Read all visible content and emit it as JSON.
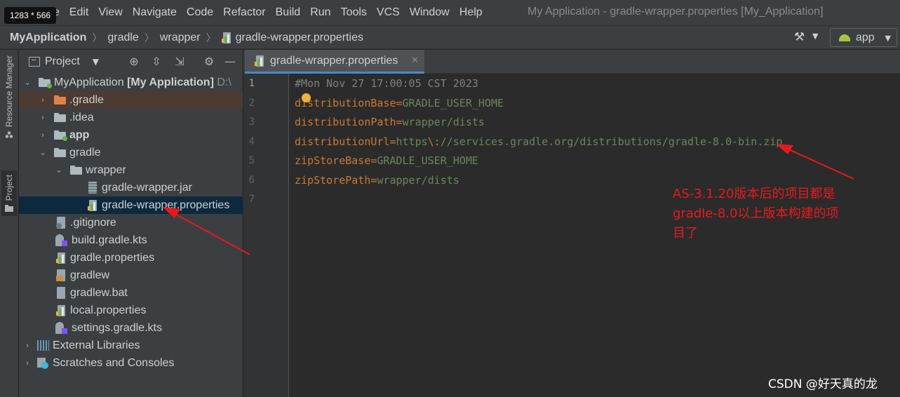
{
  "screenshot_badge": "1283 * 566",
  "menu": [
    "File",
    "Edit",
    "View",
    "Navigate",
    "Code",
    "Refactor",
    "Build",
    "Run",
    "Tools",
    "VCS",
    "Window",
    "Help"
  ],
  "window_title": "My Application - gradle-wrapper.properties [My_Application]",
  "breadcrumbs": [
    "MyApplication",
    "gradle",
    "wrapper",
    "gradle-wrapper.properties"
  ],
  "run_config": "app",
  "stripe": {
    "resource_manager": "Resource Manager",
    "project": "Project"
  },
  "panel": {
    "title": "Project"
  },
  "tree": {
    "root_name": "MyApplication",
    "root_module": "[My Application]",
    "root_path": "D:\\",
    "items": [
      ".gradle",
      ".idea",
      "app",
      "gradle",
      "wrapper",
      "gradle-wrapper.jar",
      "gradle-wrapper.properties",
      ".gitignore",
      "build.gradle.kts",
      "gradle.properties",
      "gradlew",
      "gradlew.bat",
      "local.properties",
      "settings.gradle.kts",
      "External Libraries",
      "Scratches and Consoles"
    ]
  },
  "editor": {
    "tab_label": "gradle-wrapper.properties",
    "line_numbers": [
      "1",
      "2",
      "3",
      "4",
      "5",
      "6",
      "7"
    ],
    "line1": "#Mon Nov 27 17:00:05 CST 2023",
    "line2_key": "distributionBase",
    "line2_val": "GRADLE_USER_HOME",
    "line3_key": "distributionPath",
    "line3_val": "wrapper/dists",
    "line4_key": "distributionUrl",
    "line4_val_a": "https",
    "line4_esc": "\\:",
    "line4_val_b": "//services.gradle.org/distributions/gradle-8.0-bin.zip",
    "line5_key": "zipStoreBase",
    "line5_val": "GRADLE_USER_HOME",
    "line6_key": "zipStorePath",
    "line6_val": "wrapper/dists",
    "eq": "="
  },
  "annotation": {
    "line1": "AS-3.1.20版本后的项目都是",
    "line2": "gradle-8.0以上版本构建的项",
    "line3": "目了"
  },
  "watermark": "CSDN @好天真的龙",
  "colors": {
    "annotation": "#e8191c",
    "selection": "#0d293e",
    "highlight_row": "#4b3b32",
    "tab_underline": "#4a88c7"
  }
}
